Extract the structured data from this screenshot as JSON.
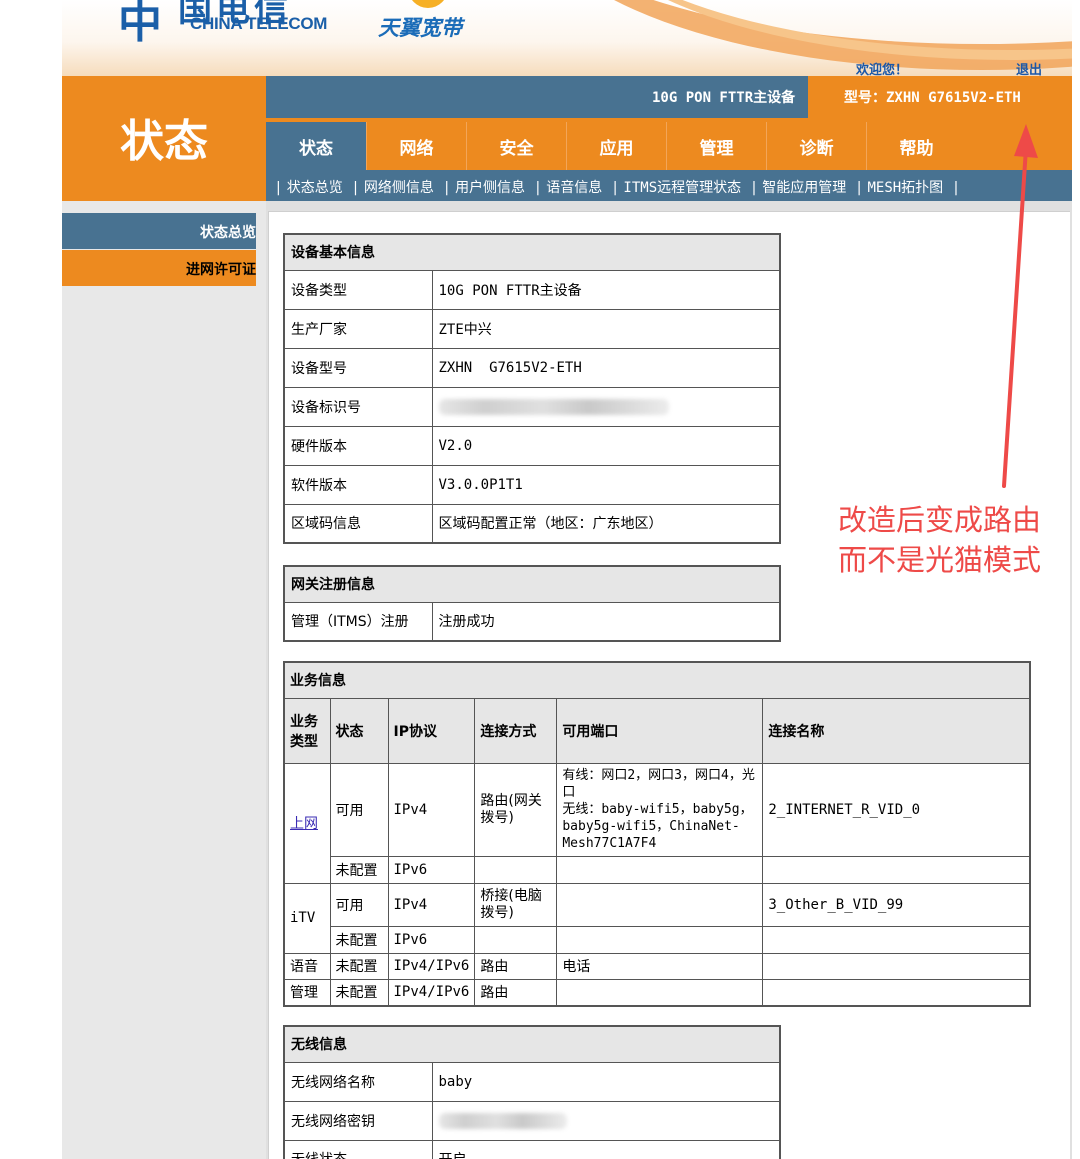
{
  "header": {
    "logo_glyph": "中",
    "logo_cn": "国电信",
    "logo_en": "CHINA TELECOM",
    "brand_cn": "天翼宽带",
    "welcome": "欢迎您！",
    "logout": "退出",
    "device_name": "10G PON FTTR主设备",
    "model": "型号：ZXHN G7615V2-ETH"
  },
  "page_title": "状态",
  "tabs": [
    {
      "label": "状态",
      "active": true
    },
    {
      "label": "网络"
    },
    {
      "label": "安全"
    },
    {
      "label": "应用"
    },
    {
      "label": "管理"
    },
    {
      "label": "诊断"
    },
    {
      "label": "帮助"
    }
  ],
  "subnav": [
    "状态总览",
    "网络侧信息",
    "用户侧信息",
    "语音信息",
    "ITMS远程管理状态",
    "智能应用管理",
    "MESH拓扑图"
  ],
  "sidebar": {
    "items": [
      "状态总览",
      "进网许可证"
    ]
  },
  "device_info": {
    "title": "设备基本信息",
    "rows": [
      {
        "k": "设备类型",
        "v": "10G PON FTTR主设备"
      },
      {
        "k": "生产厂家",
        "v": "ZTE中兴"
      },
      {
        "k": "设备型号",
        "v": "ZXHN  G7615V2-ETH"
      },
      {
        "k": "设备标识号",
        "v": ""
      },
      {
        "k": "硬件版本",
        "v": "V2.0"
      },
      {
        "k": "软件版本",
        "v": "V3.0.0P1T1"
      },
      {
        "k": "区域码信息",
        "v": "区域码配置正常（地区：广东地区）"
      }
    ]
  },
  "gateway_info": {
    "title": "网关注册信息",
    "rows": [
      {
        "k": "管理（ITMS）注册",
        "v": "注册成功"
      }
    ]
  },
  "business_info": {
    "title": "业务信息",
    "headers": [
      "业务类型",
      "状态",
      "IP协议",
      "连接方式",
      "可用端口",
      "连接名称"
    ],
    "internet": {
      "type": "上网",
      "r1": {
        "status": "可用",
        "ip": "IPv4",
        "mode": "路由(网关拨号)",
        "ports": "有线：网口2，网口3，网口4，光口\n无线：baby-wifi5，baby5g，baby5g-wifi5，ChinaNet-Mesh77C1A7F4",
        "name": "2_INTERNET_R_VID_0"
      },
      "r2": {
        "status": "未配置",
        "ip": "IPv6"
      }
    },
    "itv": {
      "type": "iTV",
      "r1": {
        "status": "可用",
        "ip": "IPv4",
        "mode": "桥接(电脑拨号)",
        "name": "3_Other_B_VID_99"
      },
      "r2": {
        "status": "未配置",
        "ip": "IPv6"
      }
    },
    "voice": {
      "type": "语音",
      "status": "未配置",
      "ip": "IPv4/IPv6",
      "mode": "路由",
      "ports": "电话"
    },
    "mgmt": {
      "type": "管理",
      "status": "未配置",
      "ip": "IPv4/IPv6",
      "mode": "路由"
    }
  },
  "wireless_info": {
    "title": "无线信息",
    "rows": [
      {
        "k": "无线网络名称",
        "v": "baby"
      },
      {
        "k": "无线网络密钥",
        "v": ""
      },
      {
        "k": "无线状态",
        "v": "开启"
      }
    ]
  },
  "annotation": {
    "line1": "改造后变成路由",
    "line2": "而不是光猫模式",
    "color": "#ee4a48"
  },
  "colors": {
    "orange": "#ed8a1f",
    "blue": "#487291"
  }
}
